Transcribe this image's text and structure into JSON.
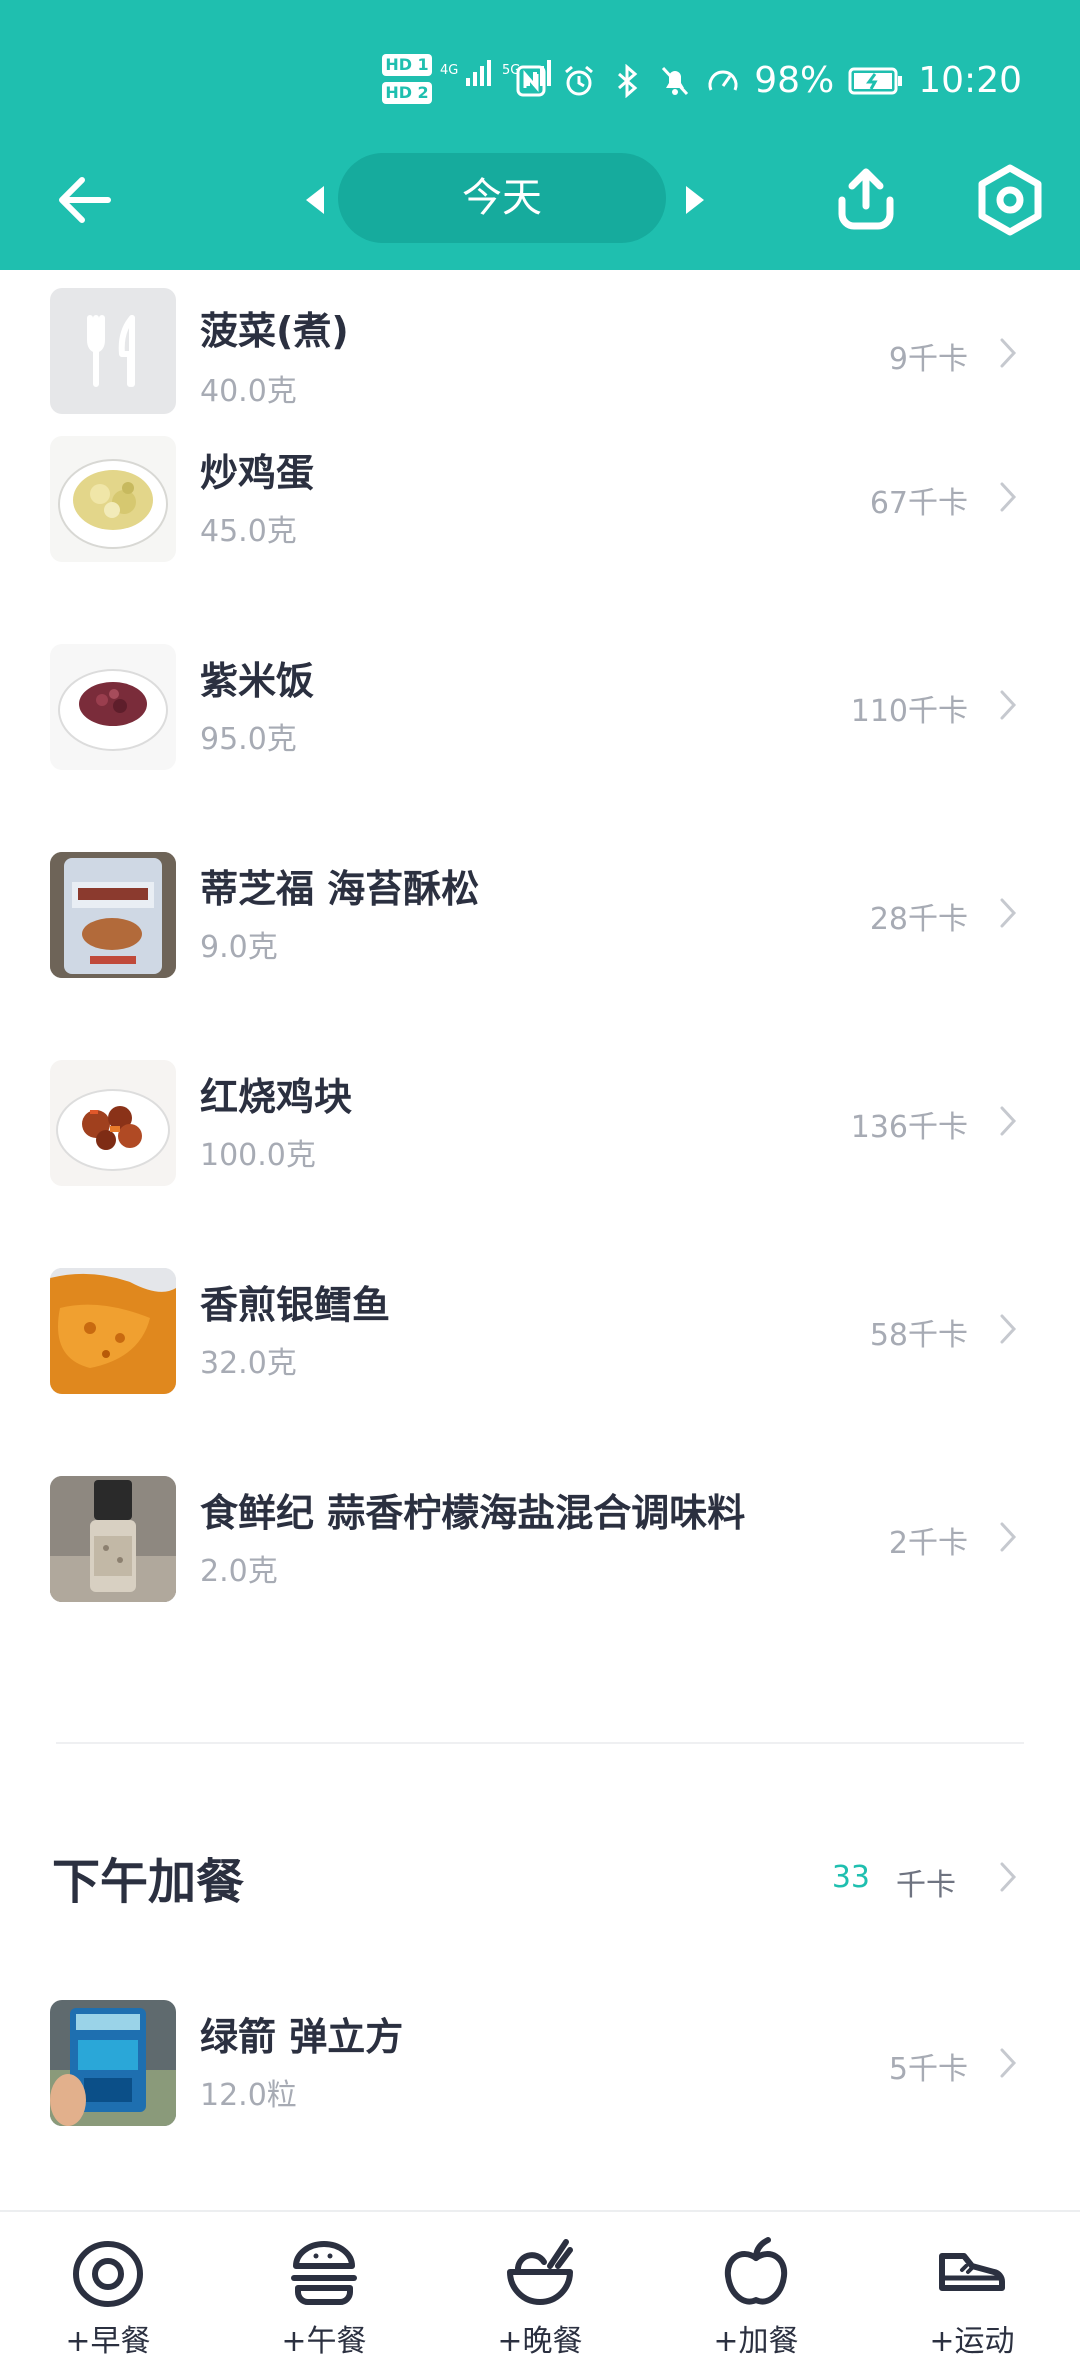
{
  "status_bar": {
    "hd1": "HD 1",
    "hd2": "HD 2",
    "net1": "4G",
    "net2": "5G",
    "battery": "98%",
    "time": "10:20"
  },
  "nav": {
    "date": "今天"
  },
  "items": [
    {
      "name": "菠菜(煮)",
      "amount": "40.0克",
      "kcal": "9千卡",
      "thumb": "placeholder"
    },
    {
      "name": "炒鸡蛋",
      "amount": "45.0克",
      "kcal": "67千卡",
      "thumb": "egg"
    },
    {
      "name": "紫米饭",
      "amount": "95.0克",
      "kcal": "110千卡",
      "thumb": "rice"
    },
    {
      "name": "蒂芝福 海苔酥松",
      "amount": "9.0克",
      "kcal": "28千卡",
      "thumb": "package"
    },
    {
      "name": "红烧鸡块",
      "amount": "100.0克",
      "kcal": "136千卡",
      "thumb": "chicken"
    },
    {
      "name": "香煎银鳕鱼",
      "amount": "32.0克",
      "kcal": "58千卡",
      "thumb": "fish"
    },
    {
      "name": "食鲜纪 蒜香柠檬海盐混合调味料",
      "amount": "2.0克",
      "kcal": "2千卡",
      "thumb": "grinder"
    }
  ],
  "section": {
    "title": "下午加餐",
    "kcal": "33",
    "unit": "千卡"
  },
  "snack_items": [
    {
      "name": "绿箭 弹立方",
      "amount": "12.0粒",
      "kcal": "5千卡",
      "thumb": "gum"
    }
  ],
  "tabs": [
    {
      "label": "+早餐",
      "icon": "breakfast-icon"
    },
    {
      "label": "+午餐",
      "icon": "burger-icon"
    },
    {
      "label": "+晚餐",
      "icon": "bowl-icon"
    },
    {
      "label": "+加餐",
      "icon": "apple-icon"
    },
    {
      "label": "+运动",
      "icon": "shoe-icon"
    }
  ],
  "colors": {
    "header": "#1fbfaf",
    "accent": "#1fbfaf",
    "text": "#2b3040",
    "muted": "#a7abb4"
  }
}
